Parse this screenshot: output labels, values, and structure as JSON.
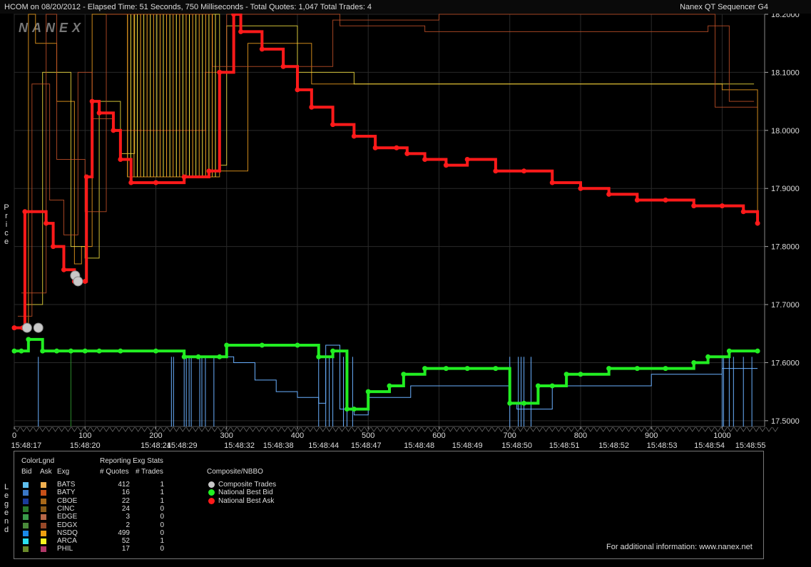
{
  "title": {
    "left": "HCOM on 08/20/2012  -  Elapsed Time: 51 Seconds, 750 Milliseconds  -  Total Quotes: 1,047  Total Trades: 4",
    "right": "Nanex QT Sequencer G4"
  },
  "watermark": "NANEX",
  "y_axis_label": "Price",
  "legend_side_label": "Legend",
  "colors": {
    "nbb": "#22ee22",
    "nbo": "#ff1a1a",
    "trade": "#c8c8c8",
    "bid_line": "#6ab0ff",
    "ask_orange": "#f0a020",
    "ask_yellow": "#f5e040",
    "ask_brown": "#c05028",
    "grid": "#2a2a2a"
  },
  "chart_data": {
    "type": "line",
    "symbol": "HCOM",
    "date": "08/20/2012",
    "ylim": [
      17.49,
      18.2
    ],
    "xlim": [
      0,
      1060
    ],
    "y_ticks": [
      "18.2000",
      "18.1000",
      "18.0000",
      "17.9000",
      "17.8000",
      "17.7000",
      "17.6000",
      "17.5000"
    ],
    "x_ticks_seq": [
      "0",
      "100",
      "200",
      "300",
      "400",
      "500",
      "600",
      "700",
      "800",
      "900",
      "1000"
    ],
    "x_ticks_time": [
      {
        "seq": 17,
        "label": "15:48:17"
      },
      {
        "seq": 100,
        "label": "15:48:20"
      },
      {
        "seq": 200,
        "label": "15:48:24"
      },
      {
        "seq": 237,
        "label": "15:48:29"
      },
      {
        "seq": 318,
        "label": "15:48:32"
      },
      {
        "seq": 373,
        "label": "15:48:38"
      },
      {
        "seq": 437,
        "label": "15:48:44"
      },
      {
        "seq": 497,
        "label": "15:48:47"
      },
      {
        "seq": 572,
        "label": "15:48:48"
      },
      {
        "seq": 640,
        "label": "15:48:49"
      },
      {
        "seq": 710,
        "label": "15:48:50"
      },
      {
        "seq": 777,
        "label": "15:48:51"
      },
      {
        "seq": 847,
        "label": "15:48:52"
      },
      {
        "seq": 915,
        "label": "15:48:53"
      },
      {
        "seq": 982,
        "label": "15:48:54"
      },
      {
        "seq": 1040,
        "label": "15:48:55"
      }
    ],
    "series": [
      {
        "name": "National Best Ask",
        "x": [
          0,
          12,
          15,
          45,
          55,
          70,
          85,
          100,
          102,
          110,
          120,
          140,
          150,
          165,
          200,
          240,
          275,
          290,
          310,
          320,
          350,
          380,
          400,
          420,
          450,
          480,
          510,
          540,
          555,
          580,
          610,
          640,
          680,
          720,
          760,
          800,
          840,
          880,
          920,
          960,
          1000,
          1030,
          1050
        ],
        "y": [
          17.66,
          17.66,
          17.86,
          17.84,
          17.8,
          17.76,
          17.74,
          17.74,
          17.92,
          18.05,
          18.03,
          18.0,
          17.95,
          17.91,
          17.91,
          17.92,
          17.93,
          18.1,
          18.2,
          18.17,
          18.14,
          18.11,
          18.07,
          18.04,
          18.01,
          17.99,
          17.97,
          17.97,
          17.96,
          17.95,
          17.94,
          17.95,
          17.93,
          17.93,
          17.91,
          17.9,
          17.89,
          17.88,
          17.88,
          17.87,
          17.87,
          17.86,
          17.84
        ]
      },
      {
        "name": "National Best Bid",
        "x": [
          0,
          10,
          20,
          40,
          60,
          80,
          100,
          120,
          150,
          200,
          240,
          260,
          290,
          300,
          350,
          400,
          430,
          450,
          470,
          480,
          500,
          530,
          550,
          580,
          610,
          640,
          680,
          700,
          720,
          740,
          760,
          780,
          800,
          840,
          880,
          920,
          960,
          980,
          1010,
          1050
        ],
        "y": [
          17.62,
          17.62,
          17.64,
          17.62,
          17.62,
          17.62,
          17.62,
          17.62,
          17.62,
          17.62,
          17.61,
          17.61,
          17.61,
          17.63,
          17.63,
          17.63,
          17.61,
          17.62,
          17.52,
          17.52,
          17.55,
          17.56,
          17.58,
          17.59,
          17.59,
          17.59,
          17.59,
          17.53,
          17.53,
          17.56,
          17.56,
          17.58,
          17.58,
          17.59,
          17.59,
          17.59,
          17.6,
          17.61,
          17.62,
          17.62
        ]
      },
      {
        "name": "Composite Trades",
        "x": [
          18,
          34,
          86,
          90
        ],
        "y": [
          17.66,
          17.66,
          17.75,
          17.74
        ]
      }
    ]
  },
  "legend": {
    "header_colorlgnd": "ColorLgnd",
    "header_bid": "Bid",
    "header_ask": "Ask",
    "header_exg": "Exg",
    "header_stats": "Reporting Exg Stats",
    "header_quotes": "# Quotes",
    "header_trades": "# Trades",
    "header_composite": "Composite/NBBO",
    "rows": [
      {
        "exg": "BATS",
        "quotes": "412",
        "trades": "1",
        "bid_color": "#5fbfef",
        "ask_color": "#f0b050"
      },
      {
        "exg": "BATY",
        "quotes": "16",
        "trades": "1",
        "bid_color": "#3a78c8",
        "ask_color": "#c85018"
      },
      {
        "exg": "CBOE",
        "quotes": "22",
        "trades": "1",
        "bid_color": "#1a3a9a",
        "ask_color": "#a86818"
      },
      {
        "exg": "CINC",
        "quotes": "24",
        "trades": "0",
        "bid_color": "#2a7a2a",
        "ask_color": "#8a5a18"
      },
      {
        "exg": "EDGE",
        "quotes": "3",
        "trades": "0",
        "bid_color": "#3a9a4a",
        "ask_color": "#b86848"
      },
      {
        "exg": "EDGX",
        "quotes": "2",
        "trades": "0",
        "bid_color": "#4a8a3a",
        "ask_color": "#984828"
      },
      {
        "exg": "NSDQ",
        "quotes": "499",
        "trades": "0",
        "bid_color": "#1a8aea",
        "ask_color": "#f0a010"
      },
      {
        "exg": "ARCA",
        "quotes": "52",
        "trades": "1",
        "bid_color": "#2ae0f0",
        "ask_color": "#f5f520"
      },
      {
        "exg": "PHIL",
        "quotes": "17",
        "trades": "0",
        "bid_color": "#6a8a2a",
        "ask_color": "#b03868"
      }
    ],
    "composite": [
      {
        "label": "Composite Trades",
        "color": "#c8c8c8"
      },
      {
        "label": "National Best Bid",
        "color": "#22ee22"
      },
      {
        "label": "National Best Ask",
        "color": "#ff1a1a"
      }
    ],
    "footer": "For additional information: www.nanex.net"
  }
}
